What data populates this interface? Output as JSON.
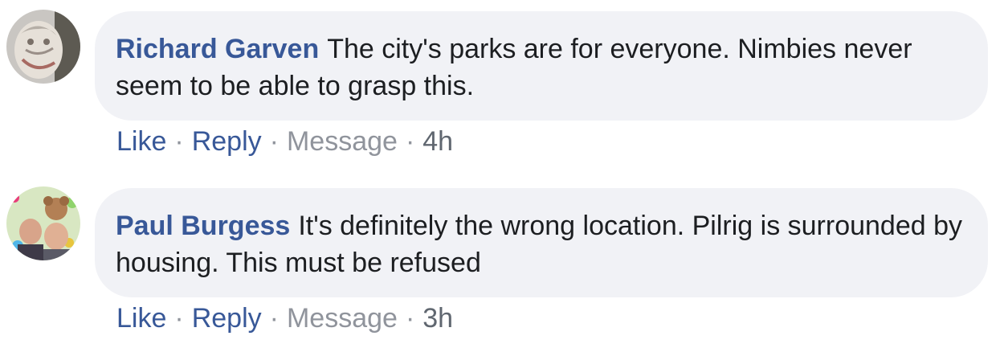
{
  "comments": [
    {
      "author": "Richard Garven",
      "text": "The city's parks are for everyone. Nimbies never seem to be able to grasp this.",
      "actions": {
        "like": "Like",
        "reply": "Reply",
        "message": "Message",
        "separator": "·",
        "time": "4h"
      }
    },
    {
      "author": "Paul Burgess",
      "text": "It's definitely the wrong location. Pilrig is surrounded by housing. This must be refused",
      "actions": {
        "like": "Like",
        "reply": "Reply",
        "message": "Message",
        "separator": "·",
        "time": "3h"
      }
    }
  ],
  "colors": {
    "author_link": "#385898",
    "bubble_bg": "#f1f2f6",
    "body_text": "#1c1e21",
    "muted": "#90949c"
  }
}
